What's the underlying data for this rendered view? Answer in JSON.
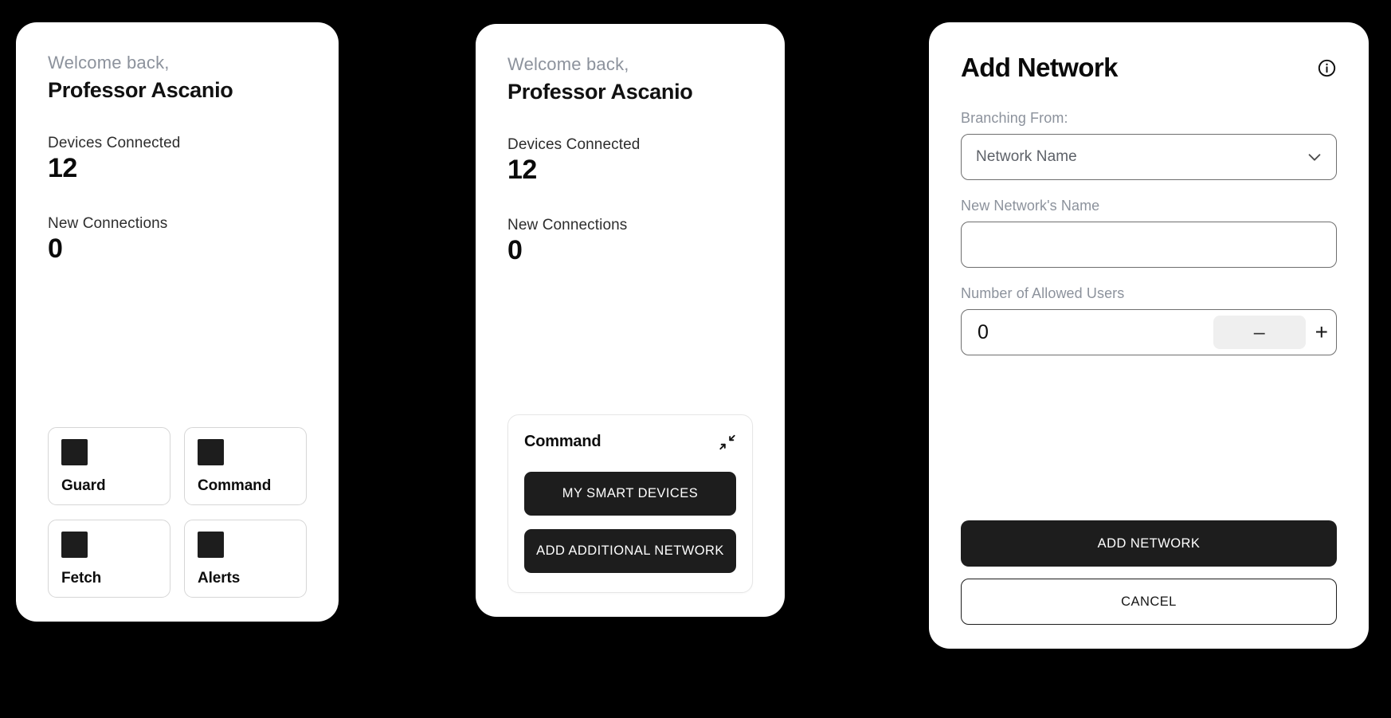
{
  "dashboard": {
    "welcome_label": "Welcome back,",
    "user_name": "Professor Ascanio",
    "stats": [
      {
        "label": "Devices Connected",
        "value": "12"
      },
      {
        "label": "New Connections",
        "value": "0"
      }
    ],
    "tiles": [
      {
        "label": "Guard",
        "icon": "square-icon"
      },
      {
        "label": "Command",
        "icon": "square-icon"
      },
      {
        "label": "Fetch",
        "icon": "square-icon"
      },
      {
        "label": "Alerts",
        "icon": "square-icon"
      }
    ]
  },
  "command_panel": {
    "welcome_label": "Welcome back,",
    "user_name": "Professor Ascanio",
    "stats": [
      {
        "label": "Devices Connected",
        "value": "12"
      },
      {
        "label": "New Connections",
        "value": "0"
      }
    ],
    "card": {
      "title": "Command",
      "collapse_icon": "collapse-arrows-icon",
      "buttons": [
        {
          "label": "MY SMART DEVICES"
        },
        {
          "label": "ADD ADDITIONAL NETWORK"
        }
      ]
    }
  },
  "add_network": {
    "title": "Add Network",
    "info_icon": "info-circle-icon",
    "branching_from": {
      "label": "Branching From:",
      "selected": "Network Name",
      "chevron_icon": "chevron-down-icon"
    },
    "new_network_name": {
      "label": "New Network's Name",
      "value": "",
      "placeholder": ""
    },
    "allowed_users": {
      "label": "Number of Allowed Users",
      "value": "0",
      "minus_label": "–",
      "plus_label": "+"
    },
    "primary_button": "ADD NETWORK",
    "secondary_button": "CANCEL"
  },
  "colors": {
    "background": "#000000",
    "card": "#ffffff",
    "dark": "#1d1d1d",
    "muted_text": "#8c929c",
    "border": "#6e6e6e",
    "tile_border": "#d6d6d6",
    "stepper_fill": "#efefef"
  }
}
